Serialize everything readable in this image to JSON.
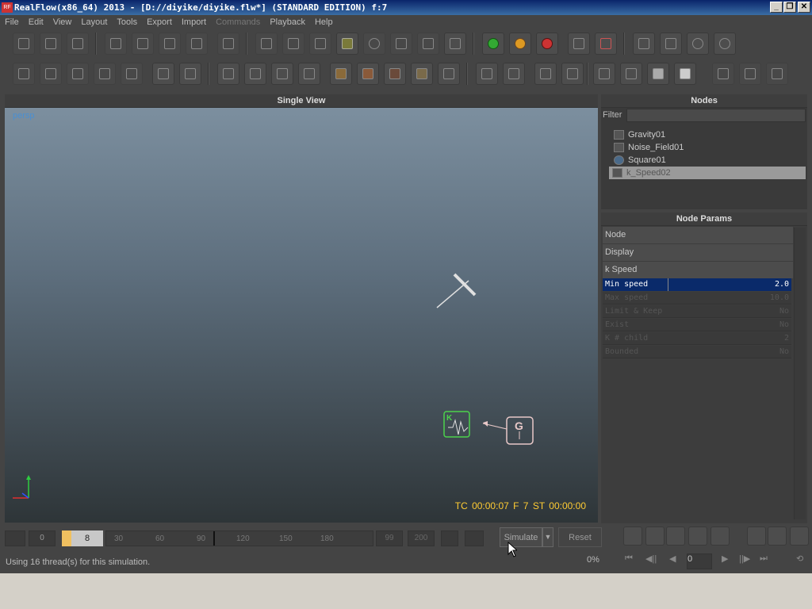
{
  "window": {
    "title": "RealFlow(x86_64) 2013 - [D://diyike/diyike.flw*] (STANDARD EDITION) f:7",
    "app_icon_text": "RF",
    "min_glyph": "_",
    "max_glyph": "❐",
    "close_glyph": "✕"
  },
  "menu": [
    "File",
    "Edit",
    "View",
    "Layout",
    "Tools",
    "Export",
    "Import",
    "Commands",
    "Playback",
    "Help"
  ],
  "view": {
    "title": "Single View",
    "camera": "persp",
    "timecode": "TC 00:00:07",
    "frame": "F 7",
    "sim_time": "ST 00:00:00"
  },
  "nodes": {
    "title": "Nodes",
    "filter_label": "Filter",
    "filter_value": "",
    "items": [
      "Gravity01",
      "Noise_Field01",
      "Square01",
      "k_Speed02"
    ],
    "selected": "k_Speed02"
  },
  "params": {
    "title": "Node Params",
    "sections": [
      "Node",
      "Display",
      "k Speed"
    ],
    "rows": [
      {
        "key": "Min speed",
        "value": "2.0"
      },
      {
        "key": "Max speed",
        "value": "10.0"
      },
      {
        "key": "Limit & Keep",
        "value": "No"
      },
      {
        "key": "Exist",
        "value": "No"
      },
      {
        "key": "K # child",
        "value": "2"
      },
      {
        "key": "Bounded",
        "value": "No"
      }
    ]
  },
  "timeline": {
    "start": "0",
    "current": "8",
    "ticks": [
      "30",
      "60",
      "90",
      "120",
      "150",
      "180"
    ],
    "end_a": "99",
    "end_b": "200"
  },
  "simulate_label": "Simulate",
  "reset_label": "Reset",
  "status_text": "Using 16 thread(s) for this simulation.",
  "progress": "0%",
  "playback": {
    "first": "⏮",
    "prev_key": "◀||",
    "prev": "◀",
    "next": "▶",
    "next_key": "||▶",
    "last": "⏭",
    "loop": "⟲"
  },
  "frame_field": "0",
  "colors": {
    "accent": "#0a246a",
    "hud": "#ffcc33",
    "persp": "#4a8fd1",
    "selection": "#9a9a9a"
  }
}
